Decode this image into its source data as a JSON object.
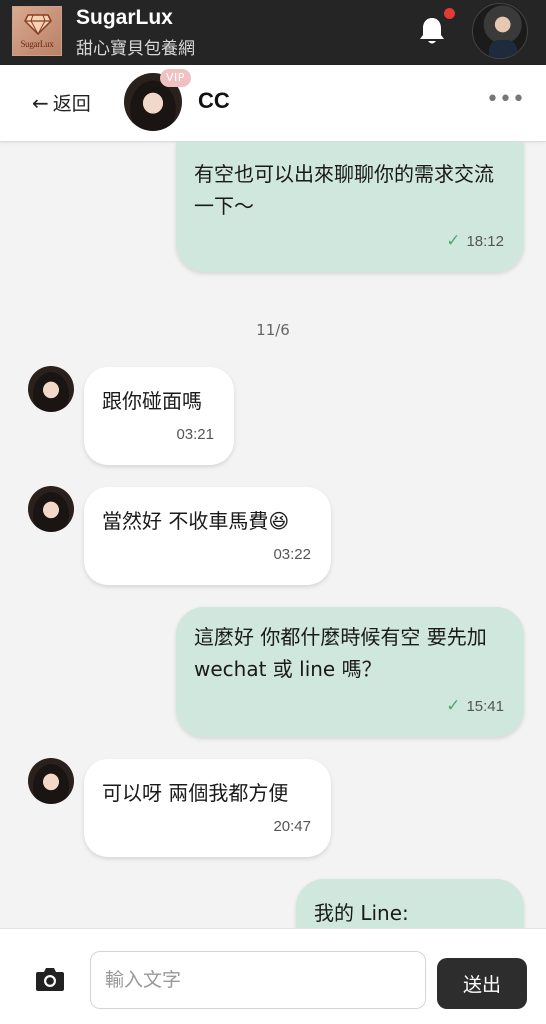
{
  "app": {
    "logo_text": "SugarLux",
    "name": "SugarLux",
    "subtitle": "甜心寶貝包養網",
    "notification_unread": true
  },
  "header": {
    "back_label": "返回",
    "contact_name": "CC",
    "vip_badge": "VIP",
    "more_label": "•••"
  },
  "messages": [
    {
      "side": "out",
      "text": "有空也可以出來聊聊你的需求交流一下～",
      "time": "18:12",
      "read": true
    },
    {
      "side": "date",
      "text": "11/6"
    },
    {
      "side": "in",
      "text": "跟你碰面嗎",
      "time": "03:21"
    },
    {
      "side": "in",
      "text": "當然好 不收車馬費😆",
      "time": "03:22"
    },
    {
      "side": "out",
      "text": "這麼好 你都什麼時候有空 要先加 wechat 或 line 嗎？",
      "time": "15:41",
      "read": true
    },
    {
      "side": "in",
      "text": "可以呀 兩個我都方便",
      "time": "20:47"
    },
    {
      "side": "out",
      "text": "我的 Line:",
      "time": "",
      "read": false
    }
  ],
  "composer": {
    "placeholder": "輸入文字",
    "send_label": "送出"
  },
  "colors": {
    "topbar": "#252525",
    "outgoing_bubble": "#cfe7dc",
    "incoming_bubble": "#ffffff",
    "read_check": "#4aaa78",
    "notification_dot": "#e53935"
  }
}
